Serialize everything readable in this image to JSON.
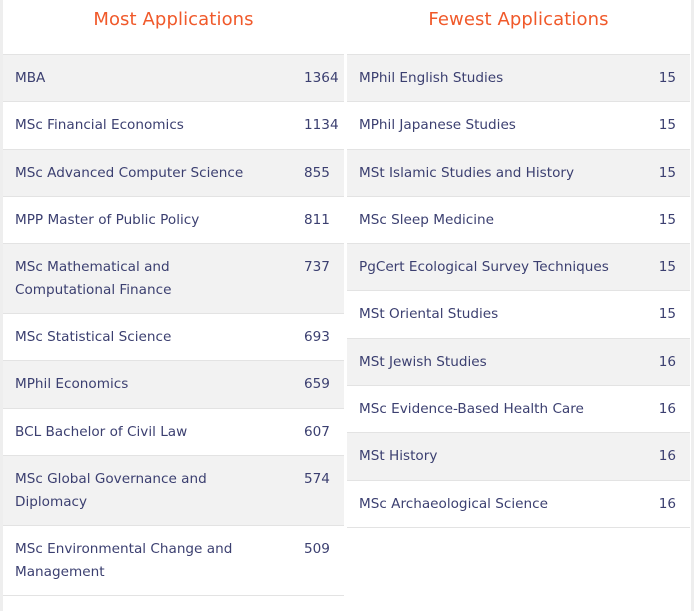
{
  "most": {
    "title": "Most Applications",
    "rows": [
      {
        "name": "MBA",
        "count": "1364"
      },
      {
        "name": "MSc Financial Economics",
        "count": "1134"
      },
      {
        "name": "MSc Advanced Computer Science",
        "count": "855"
      },
      {
        "name": "MPP Master of Public Policy",
        "count": "811"
      },
      {
        "name": "MSc Mathematical and Computational Finance",
        "count": "737"
      },
      {
        "name": "MSc Statistical Science",
        "count": "693"
      },
      {
        "name": "MPhil Economics",
        "count": "659"
      },
      {
        "name": "BCL Bachelor of Civil Law",
        "count": "607"
      },
      {
        "name": "MSc Global Governance and Diplomacy",
        "count": "574"
      },
      {
        "name": "MSc Environmental Change and Management",
        "count": "509"
      }
    ]
  },
  "fewest": {
    "title": "Fewest Applications",
    "rows": [
      {
        "name": "MPhil English Studies",
        "count": "15"
      },
      {
        "name": "MPhil Japanese Studies",
        "count": "15"
      },
      {
        "name": "MSt Islamic Studies and History",
        "count": "15"
      },
      {
        "name": "MSc Sleep Medicine",
        "count": "15"
      },
      {
        "name": "PgCert Ecological Survey Techniques",
        "count": "15"
      },
      {
        "name": "MSt Oriental Studies",
        "count": "15"
      },
      {
        "name": "MSt Jewish Studies",
        "count": "16"
      },
      {
        "name": "MSc Evidence-Based Health Care",
        "count": "16"
      },
      {
        "name": "MSt History",
        "count": "16"
      },
      {
        "name": "MSc Archaeological Science",
        "count": "16"
      }
    ]
  }
}
